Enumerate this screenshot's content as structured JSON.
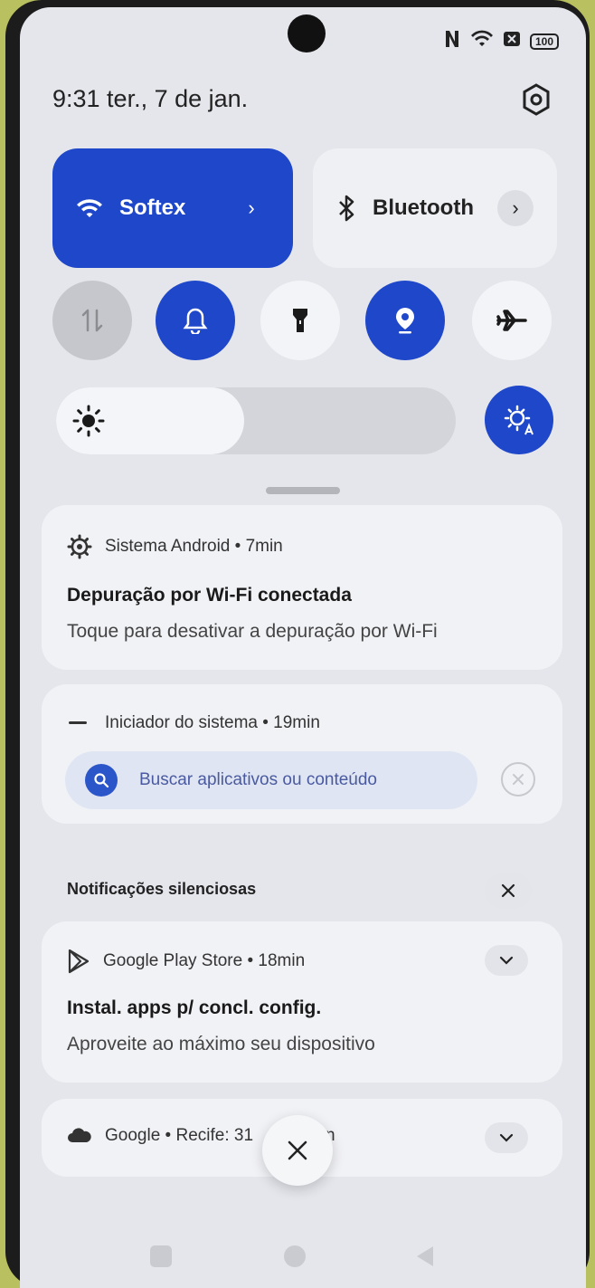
{
  "status_bar": {
    "battery": "100"
  },
  "header": {
    "time_date": "9:31  ter., 7 de jan."
  },
  "quick_settings": {
    "wifi_label": "Softex",
    "bluetooth_label": "Bluetooth",
    "brightness_level": 0.47
  },
  "notifications": [
    {
      "app": "Sistema Android • 7min",
      "title": "Depuração por Wi-Fi conectada",
      "text": "Toque para desativar a depuração por Wi-Fi"
    },
    {
      "app": "Iniciador do sistema • 19min",
      "search_placeholder": "Buscar aplicativos ou conteúdo"
    }
  ],
  "silent_section": {
    "label": "Notificações silenciosas",
    "items": [
      {
        "app": "Google Play Store • 18min",
        "title": "Instal. apps p/ concl. config.",
        "text": "Aproveite ao máximo seu dispositivo"
      },
      {
        "app": "Google • Recife: 31",
        "app_tail": "n"
      }
    ]
  },
  "colors": {
    "accent": "#1e47c9",
    "surface": "#f1f2f6",
    "background": "#e4e6ec"
  }
}
